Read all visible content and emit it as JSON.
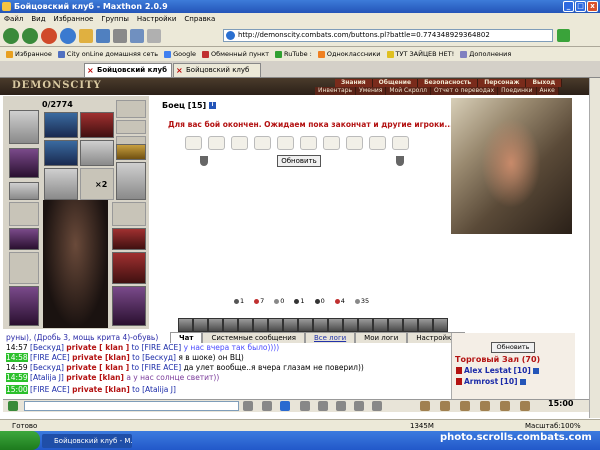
{
  "window": {
    "title": "Бойцовский клуб - Maxthon 2.0.9",
    "buttons": [
      "_",
      "□",
      "x"
    ]
  },
  "menu": [
    "Файл",
    "Вид",
    "Избранное",
    "Группы",
    "Настройки",
    "Справка"
  ],
  "address": {
    "url": "http://demonscity.combats.com/buttons.pl?battle=0.774348929364802"
  },
  "favorites": [
    {
      "label": "Избранное",
      "color": "#e8a020"
    },
    {
      "label": "City onLine домашняя сеть",
      "color": "#5070c0"
    },
    {
      "label": "Google",
      "color": "#4080f0"
    },
    {
      "label": "Обменный пункт",
      "color": "#c03030"
    },
    {
      "label": "RuTube :",
      "color": "#30a030"
    },
    {
      "label": "Одноклассники",
      "color": "#f08020"
    },
    {
      "label": "ТУТ ЗАЙЦЕВ НЕТ!",
      "color": "#e0c020"
    },
    {
      "label": "Дополнения",
      "color": "#8080c0"
    }
  ],
  "tabs": [
    {
      "label": "Бойцовский клуб",
      "active": true
    },
    {
      "label": "Бойцовский клуб",
      "active": false
    }
  ],
  "game": {
    "logo": "DEMONSCITY",
    "nav_top": [
      "Знания",
      "Общение",
      "Безопасность",
      "Персонаж",
      "Выход"
    ],
    "nav_bottom": [
      "Инвентарь",
      "Умения",
      "Мой Скролл",
      "Отчет о переводах",
      "Поединки",
      "Анке"
    ]
  },
  "inventory": {
    "count": "0/2774",
    "stack": "×2"
  },
  "fight": {
    "fighter_name": "Боец",
    "fighter_level": "[15]",
    "message": "Для вас бой окончен. Ожидаем пока закончат и другие игроки...",
    "refresh_label": "Обновить",
    "stats": [
      "1",
      "7",
      "0",
      "1",
      "0",
      "4",
      "35"
    ],
    "stat_colors": [
      "#555",
      "#c03030",
      "#888",
      "#333",
      "#333",
      "#c03030",
      "#888"
    ]
  },
  "chat_tabs": [
    {
      "label": "Чат",
      "active": true,
      "link": false
    },
    {
      "label": "Системные сообщения",
      "active": false,
      "link": false
    },
    {
      "label": "Все логи",
      "active": false,
      "link": true
    },
    {
      "label": "Мои логи",
      "active": false,
      "link": false
    },
    {
      "label": "Настройки",
      "active": false,
      "link": false
    }
  ],
  "chat": {
    "lines": [
      {
        "prefix": "руны), (Дробь 3, мощь крита 4)-обувь)",
        "time": "",
        "hl": false,
        "nick": "",
        "priv": "",
        "to": "",
        "msg": "",
        "msg_class": ""
      },
      {
        "prefix": "",
        "time": "14:57",
        "hl": false,
        "nick": "[Бескуд]",
        "priv": "private [ klan ]",
        "to": "to [FIRE ACE]",
        "msg": "у нас вчера так было))))",
        "msg_class": "msg-blue"
      },
      {
        "prefix": "",
        "time": "14:58",
        "hl": true,
        "nick": "[FIRE ACE]",
        "priv": "private [klan]",
        "to": "to [Бескуд]",
        "msg": "я в шоке) он ВЦ)",
        "msg_class": ""
      },
      {
        "prefix": "",
        "time": "14:59",
        "hl": false,
        "nick": "[Бескуд]",
        "priv": "private [ klan ]",
        "to": "to [FIRE ACE]",
        "msg": "да улет вообще..я вчера глазам не поверил))",
        "msg_class": ""
      },
      {
        "prefix": "",
        "time": "14:59",
        "hl": true,
        "nick": "[Atalija J]",
        "priv": "private [klan]",
        "to": "",
        "msg": "а у нас солнце светит))",
        "msg_class": "msg-purple"
      },
      {
        "prefix": "",
        "time": "15:00",
        "hl": true,
        "nick": "[FIRE ACE]",
        "priv": "private [klan]",
        "to": "to [Atalija J]",
        "msg": "",
        "msg_class": ""
      }
    ]
  },
  "side": {
    "refresh_label": "Обновить",
    "room": "Торговый Зал (70)",
    "players": [
      {
        "name": "Alex Lestat",
        "level": "[10]"
      },
      {
        "name": "Armrost",
        "level": "[10]"
      }
    ]
  },
  "clock": "15:00",
  "status": {
    "text": "Готово",
    "memory": "1345M",
    "zoom": "Масштаб:100%"
  },
  "taskbar": {
    "item": "Бойцовский клуб - M...",
    "watermark": "photo.scrolls.combats.com"
  }
}
